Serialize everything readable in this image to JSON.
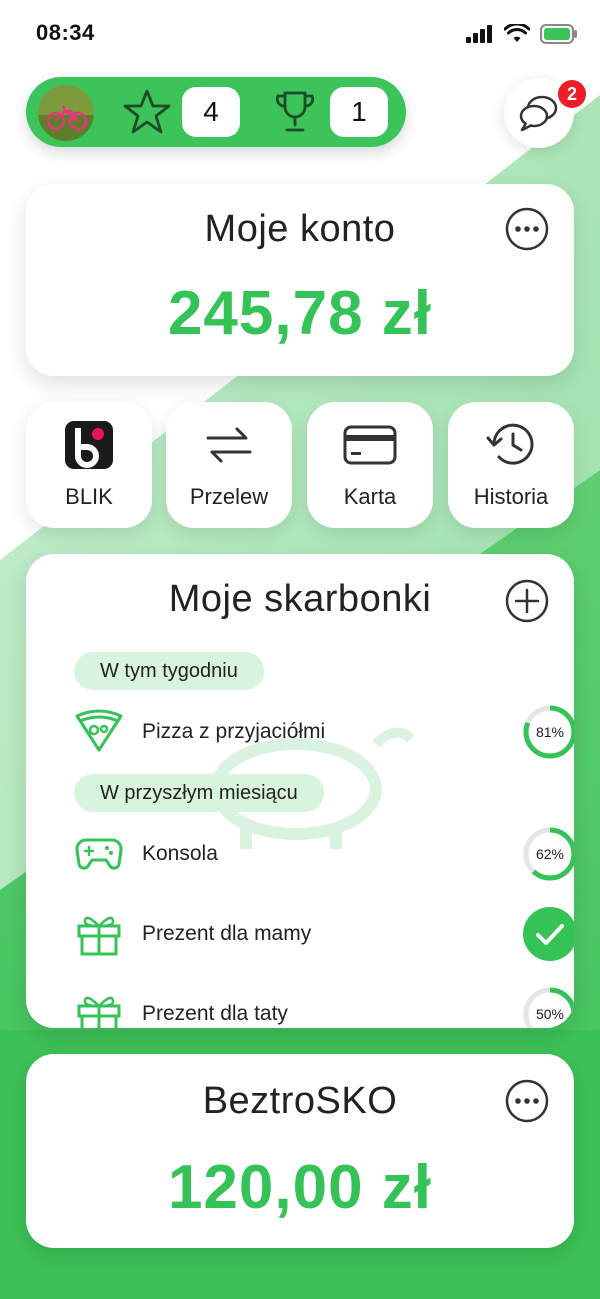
{
  "status_bar": {
    "time": "08:34"
  },
  "top_bar": {
    "stars_count": "4",
    "trophies_count": "1",
    "chat_badge_count": "2"
  },
  "main_account": {
    "title": "Moje konto",
    "balance": "245,78 zł"
  },
  "actions": [
    {
      "label": "BLIK",
      "icon": "blik-icon"
    },
    {
      "label": "Przelew",
      "icon": "transfer-icon"
    },
    {
      "label": "Karta",
      "icon": "card-icon"
    },
    {
      "label": "Historia",
      "icon": "history-icon"
    }
  ],
  "piggy_banks": {
    "title": "Moje skarbonki",
    "sections": [
      {
        "label": "W tym tygodniu",
        "items": [
          {
            "name": "Pizza z przyjaciółmi",
            "icon": "pizza-icon",
            "progress_label": "81%",
            "progress": 0.81
          }
        ]
      },
      {
        "label": "W przyszłym miesiącu",
        "items": [
          {
            "name": "Konsola",
            "icon": "gamepad-icon",
            "progress_label": "62%",
            "progress": 0.62
          },
          {
            "name": "Prezent dla mamy",
            "icon": "gift-icon",
            "progress_label": "",
            "progress": 1.0,
            "completed": true
          },
          {
            "name": "Prezent dla taty",
            "icon": "gift-icon",
            "progress_label": "50%",
            "progress": 0.5
          }
        ]
      }
    ]
  },
  "second_account": {
    "title": "BeztroSKO",
    "balance": "120,00 zł"
  },
  "colors": {
    "accent": "#35c257",
    "accent_light": "#d8f3de",
    "badge": "#ee1c25",
    "ring_track": "#e6e6e6"
  }
}
